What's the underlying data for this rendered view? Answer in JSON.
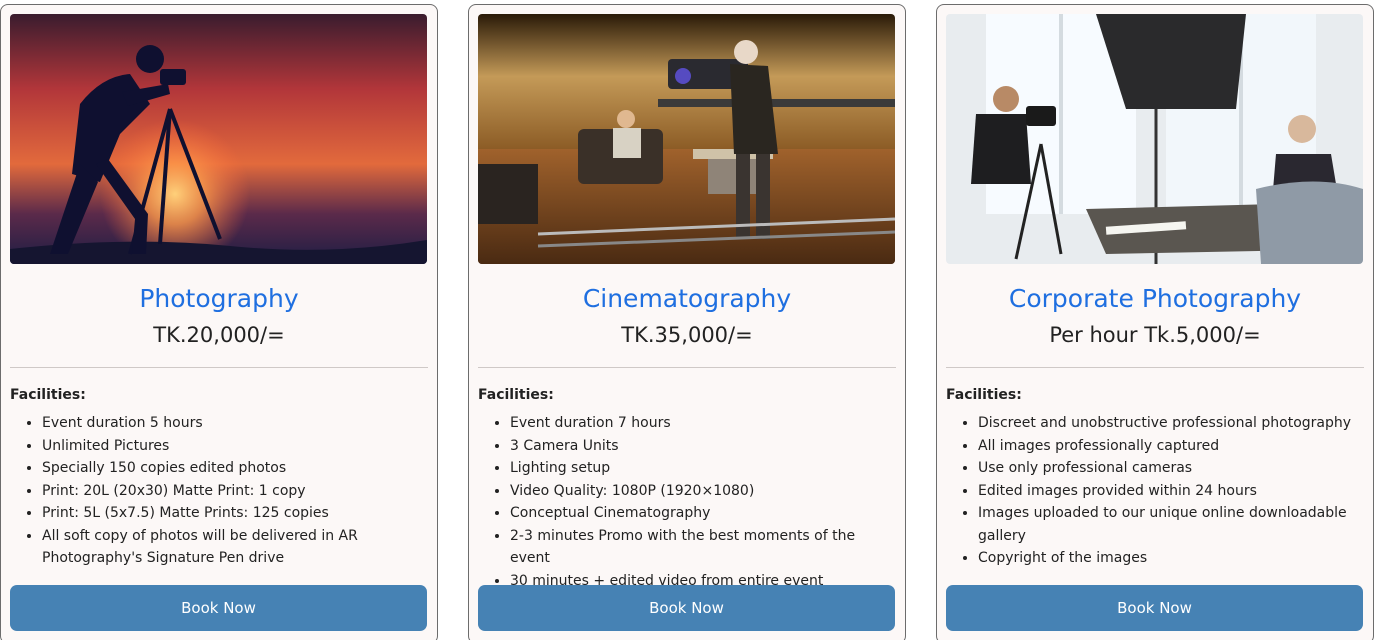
{
  "cards": [
    {
      "title": "Photography",
      "price": "TK.20,000/=",
      "facilities_label": "Facilities:",
      "features": [
        "Event duration 5 hours",
        "Unlimited Pictures",
        "Specially 150 copies edited photos",
        "Print: 20L (20x30) Matte Print: 1 copy",
        "Print: 5L (5x7.5) Matte Prints: 125 copies",
        "All soft copy of photos will be delivered in AR Photography's Signature Pen drive"
      ],
      "button_label": "Book Now",
      "image": "photographer-silhouette-sunset"
    },
    {
      "title": "Cinematography",
      "price": "TK.35,000/=",
      "facilities_label": "Facilities:",
      "features": [
        "Event duration 7 hours",
        "3 Camera Units",
        "Lighting setup",
        "Video Quality: 1080P (1920×1080)",
        "Conceptual Cinematography",
        "2-3 minutes Promo with the best moments of the event",
        "30 minutes + edited video from entire event"
      ],
      "button_label": "Book Now",
      "image": "film-crew-on-set"
    },
    {
      "title": "Corporate Photography",
      "price": "Per hour Tk.5,000/=",
      "facilities_label": "Facilities:",
      "features": [
        "Discreet and unobstructive professional photography",
        "All images professionally captured",
        "Use only professional cameras",
        "Edited images provided within 24 hours",
        "Images uploaded to our unique online downloadable gallery",
        "Copyright of the images"
      ],
      "button_label": "Book Now",
      "image": "corporate-studio-shoot"
    }
  ],
  "colors": {
    "title": "#1f6fe0",
    "button": "#4682b4",
    "card_bg": "#fcf8f7"
  }
}
